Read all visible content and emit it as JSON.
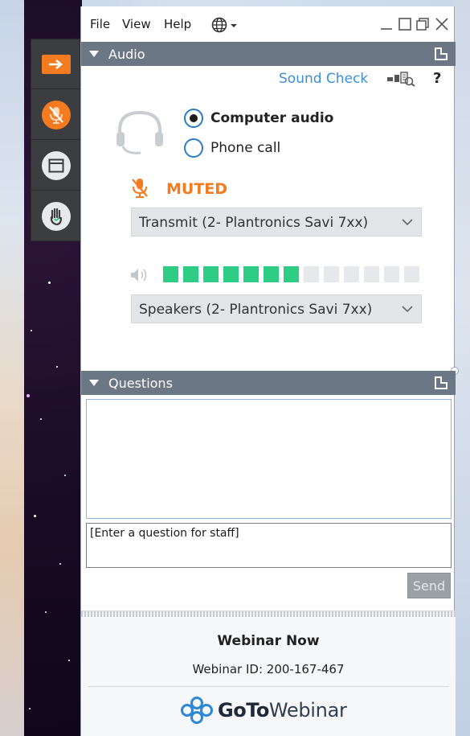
{
  "menu": {
    "file": "File",
    "view": "View",
    "help": "Help"
  },
  "audio_panel": {
    "title": "Audio",
    "sound_check": "Sound Check",
    "help": "?",
    "options": [
      {
        "label": "Computer audio",
        "selected": true
      },
      {
        "label": "Phone call",
        "selected": false
      }
    ],
    "mute_status": "MUTED",
    "transmit_device": "Transmit (2- Plantronics Savi 7xx)",
    "speaker_device": "Speakers (2- Plantronics Savi 7xx)",
    "speaker_level": {
      "filled_segments": 7,
      "total_segments": 13
    }
  },
  "questions_panel": {
    "title": "Questions",
    "input_placeholder": "[Enter a question for staff]",
    "send_label": "Send"
  },
  "footer": {
    "webinar_title": "Webinar Now",
    "webinar_id": "Webinar ID: 200-167-467",
    "logo_bold": "GoTo",
    "logo_regular": "Webinar"
  },
  "colors": {
    "accent_orange": "#f47b20",
    "link_blue": "#3d8fd8",
    "level_green": "#2ecc85",
    "level_empty": "#e6e8eb",
    "header_gray": "#6b7784",
    "toolbar_dark": "#3c3d40"
  },
  "icons": {
    "toolbar": [
      "arrow-right-icon",
      "microphone-muted-icon",
      "window-icon",
      "raise-hand-icon"
    ],
    "audio": [
      "headset-icon",
      "microphone-muted-icon",
      "speaker-icon",
      "sound-check-icon",
      "chevron-down-icon"
    ],
    "window": [
      "globe-icon",
      "minimize-icon",
      "restore-icon",
      "close-icon",
      "popout-icon"
    ],
    "footer": [
      "gotowebinar-logo-icon"
    ]
  }
}
